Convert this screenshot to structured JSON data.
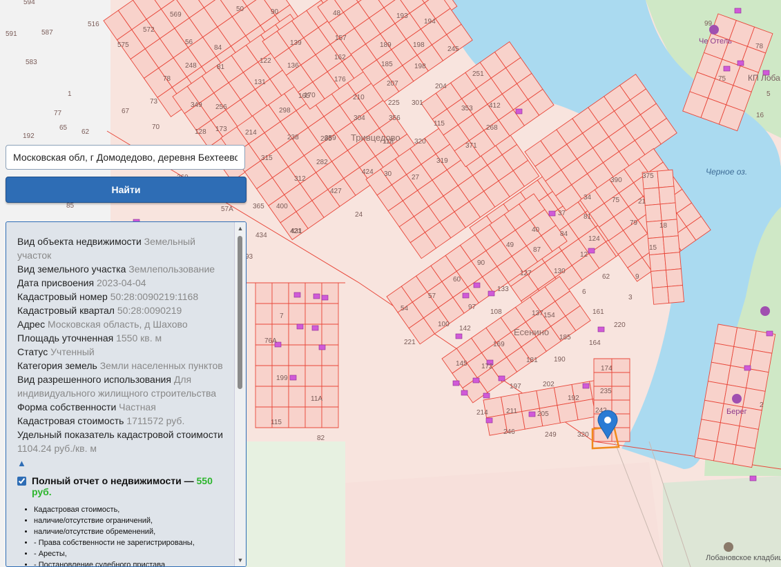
{
  "map": {
    "labels": {
      "lake": "Черное оз.",
      "village_1": "Тривцедово",
      "village_2": "Есенино",
      "hotel": "Че Отель",
      "cemetery": "Лобановское кладбище",
      "kp": "КП Лоба",
      "area_3": "Берег"
    },
    "parcel_numbers": [
      "594",
      "591",
      "587",
      "516",
      "583",
      "1",
      "77",
      "192",
      "65",
      "62",
      "572",
      "569",
      "575",
      "78",
      "73",
      "67",
      "70",
      "50",
      "90",
      "48",
      "193",
      "194",
      "56",
      "84",
      "139",
      "157",
      "189",
      "198",
      "245",
      "248",
      "81",
      "122",
      "136",
      "162",
      "185",
      "198",
      "251",
      "349",
      "128",
      "131",
      "165",
      "176",
      "207",
      "204",
      "256",
      "298",
      "170",
      "210",
      "225",
      "301",
      "353",
      "412",
      "173",
      "214",
      "238",
      "285",
      "304",
      "356",
      "115",
      "268",
      "273",
      "315",
      "312",
      "282",
      "359",
      "118",
      "320",
      "319",
      "371",
      "369",
      "365",
      "400",
      "421",
      "427",
      "424",
      "30",
      "27",
      "375",
      "390",
      "434",
      "431",
      "24",
      "34",
      "75",
      "21",
      "37",
      "81",
      "79",
      "18",
      "40",
      "84",
      "124",
      "15",
      "49",
      "87",
      "12",
      "90",
      "130",
      "62",
      "127",
      "9",
      "60",
      "133",
      "6",
      "57",
      "97",
      "108",
      "137",
      "154",
      "161",
      "3",
      "54",
      "100",
      "142",
      "169",
      "185",
      "164",
      "220",
      "221",
      "145",
      "172",
      "181",
      "190",
      "174",
      "197",
      "202",
      "192",
      "235",
      "214",
      "211",
      "205",
      "242",
      "246",
      "249",
      "320",
      "57А",
      "85",
      "93",
      "7",
      "76А",
      "199",
      "11А",
      "115",
      "82",
      "99",
      "78",
      "75",
      "5",
      "16",
      "2"
    ]
  },
  "search": {
    "value": "Московская обл, г Домодедово, деревня Бехтеево",
    "button_label": "Найти"
  },
  "property": [
    {
      "label": "Вид объекта недвижимости",
      "value": "Земельный участок"
    },
    {
      "label": "Вид земельного участка",
      "value": "Землепользование"
    },
    {
      "label": "Дата присвоения",
      "value": "2023-04-04"
    },
    {
      "label": "Кадастровый номер",
      "value": "50:28:0090219:1168"
    },
    {
      "label": "Кадастровый квартал",
      "value": "50:28:0090219"
    },
    {
      "label": "Адрес",
      "value": "Московская область, д Шахово"
    },
    {
      "label": "Площадь уточненная",
      "value": "1550 кв. м"
    },
    {
      "label": "Статус",
      "value": "Учтенный"
    },
    {
      "label": "Категория земель",
      "value": "Земли населенных пунктов"
    },
    {
      "label": "Вид разрешенного использования",
      "value": "Для индивидуального жилищного строительства"
    },
    {
      "label": "Форма собственности",
      "value": "Частная"
    },
    {
      "label": "Кадастровая стоимость",
      "value": "1711572 руб."
    },
    {
      "label": "Удельный показатель кадастровой стоимости",
      "value": "1104.24 руб./кв. м"
    }
  ],
  "collapse_icon": "▲",
  "report": {
    "title": "Полный отчет о недвижимости —",
    "price": "550 руб.",
    "checked": true,
    "items": [
      "Кадастровая стоимость,",
      "наличие/отсутствие ограничений,",
      "наличие/отсутствие обременений,",
      "- Права собственности не зарегистрированы,",
      "- Аресты,",
      "- Постановление судебного пристава"
    ]
  },
  "colors": {
    "parcel_fill": "#f8d2cb",
    "parcel_stroke": "#e8473a",
    "water": "#aadaf0",
    "forest": "#cde8c4",
    "button": "#2e6db5",
    "price": "#2cb52c",
    "marker": "#2a7bd4",
    "selected_parcel": "#f08a1c"
  }
}
